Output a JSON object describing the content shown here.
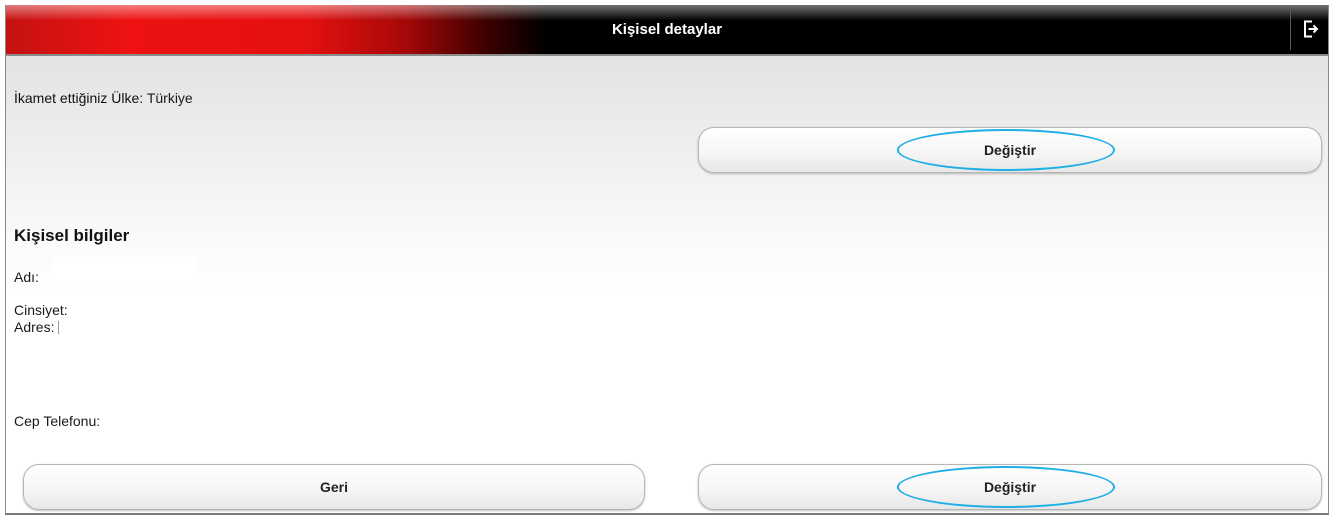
{
  "header": {
    "title": "Kişisel detaylar",
    "logout_icon": "logout-icon"
  },
  "country": {
    "label": "İkamet ettiğiniz Ülke:",
    "value": "Türkiye"
  },
  "buttons": {
    "change_top": "Değiştir",
    "back": "Geri",
    "change_bottom": "Değiştir"
  },
  "personal": {
    "title": "Kişisel bilgiler",
    "name_label": "Adı:",
    "gender_label": "Cinsiyet:",
    "address_label": "Adres:",
    "phone_label": "Cep Telefonu:"
  },
  "colors": {
    "header_red": "#e51010",
    "header_black": "#000000",
    "highlight": "#1eaee6"
  }
}
